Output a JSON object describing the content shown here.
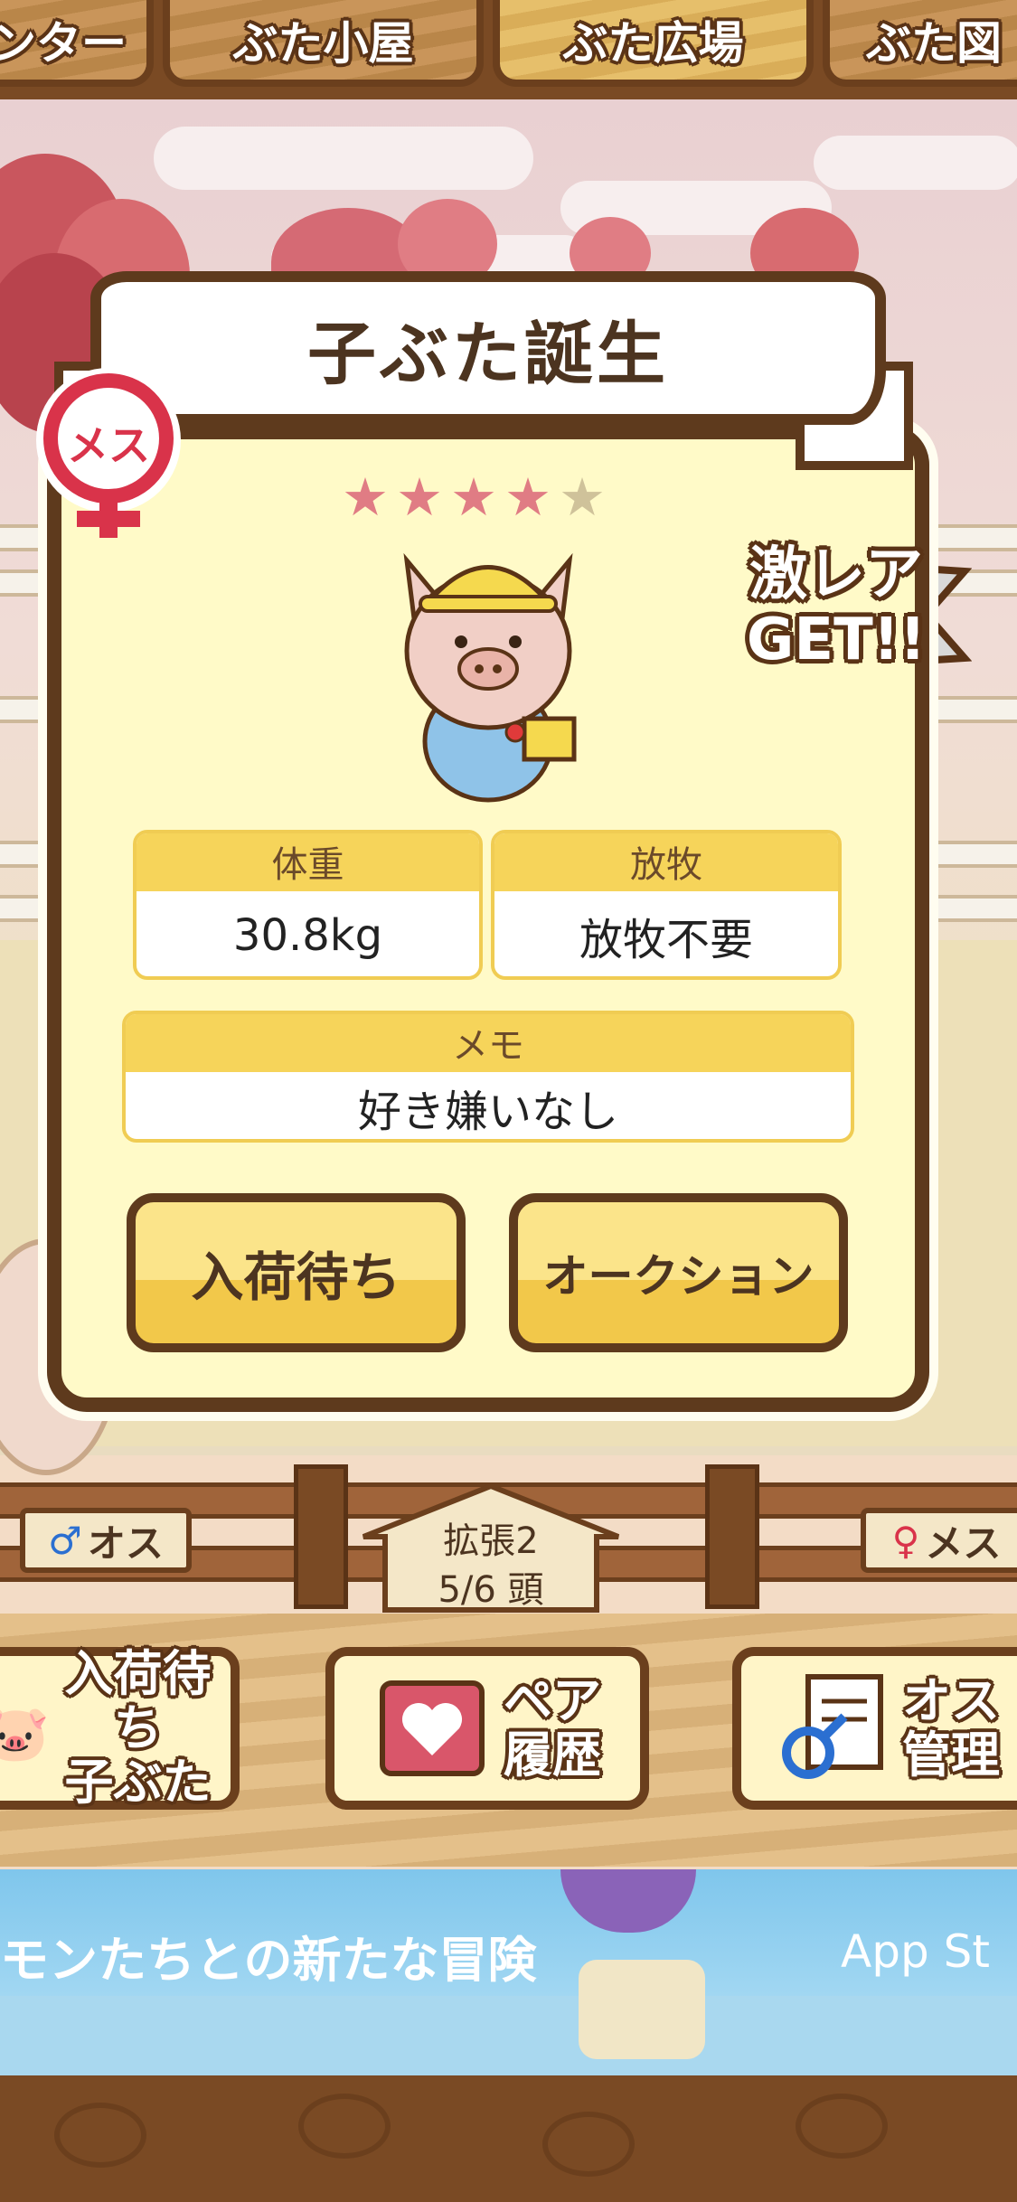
{
  "tabs": [
    {
      "label": "ンター",
      "active": false
    },
    {
      "label": "ぶた小屋",
      "active": false
    },
    {
      "label": "ぶた広場",
      "active": true
    },
    {
      "label": "ぶた図",
      "active": false
    }
  ],
  "dialog": {
    "title": "子ぶた誕生",
    "gender_badge": "メス",
    "rarity": {
      "filled": 4,
      "total": 5
    },
    "rare_badge": {
      "line1": "激レア",
      "line2": "GET!!"
    },
    "weight": {
      "label": "体重",
      "value": "30.8kg"
    },
    "grazing": {
      "label": "放牧",
      "value": "放牧不要"
    },
    "memo": {
      "label": "メモ",
      "value": "好き嫌いなし"
    },
    "buttons": {
      "wait": "入荷待ち",
      "auction": "オークション"
    }
  },
  "pen": {
    "male_sign": "オス",
    "female_sign": "メス",
    "expansion": "拡張2",
    "count": "5/6 頭"
  },
  "nav": [
    {
      "label_line1": "入荷待ち",
      "label_line2": "子ぶた",
      "icon": "piglet-icon"
    },
    {
      "label_line1": "ペア",
      "label_line2": "履歴",
      "icon": "heart-book-icon"
    },
    {
      "label_line1": "オス",
      "label_line2": "管理",
      "icon": "male-document-icon"
    }
  ],
  "ad": {
    "text": "モンたちとの新たな冒険",
    "store": "App St"
  },
  "colors": {
    "accent": "#f6d45a",
    "frame": "#5e3a1d",
    "female": "#d9334a",
    "male": "#2b6fd1",
    "star_filled": "#e07c84",
    "star_empty": "#cfc29a"
  }
}
